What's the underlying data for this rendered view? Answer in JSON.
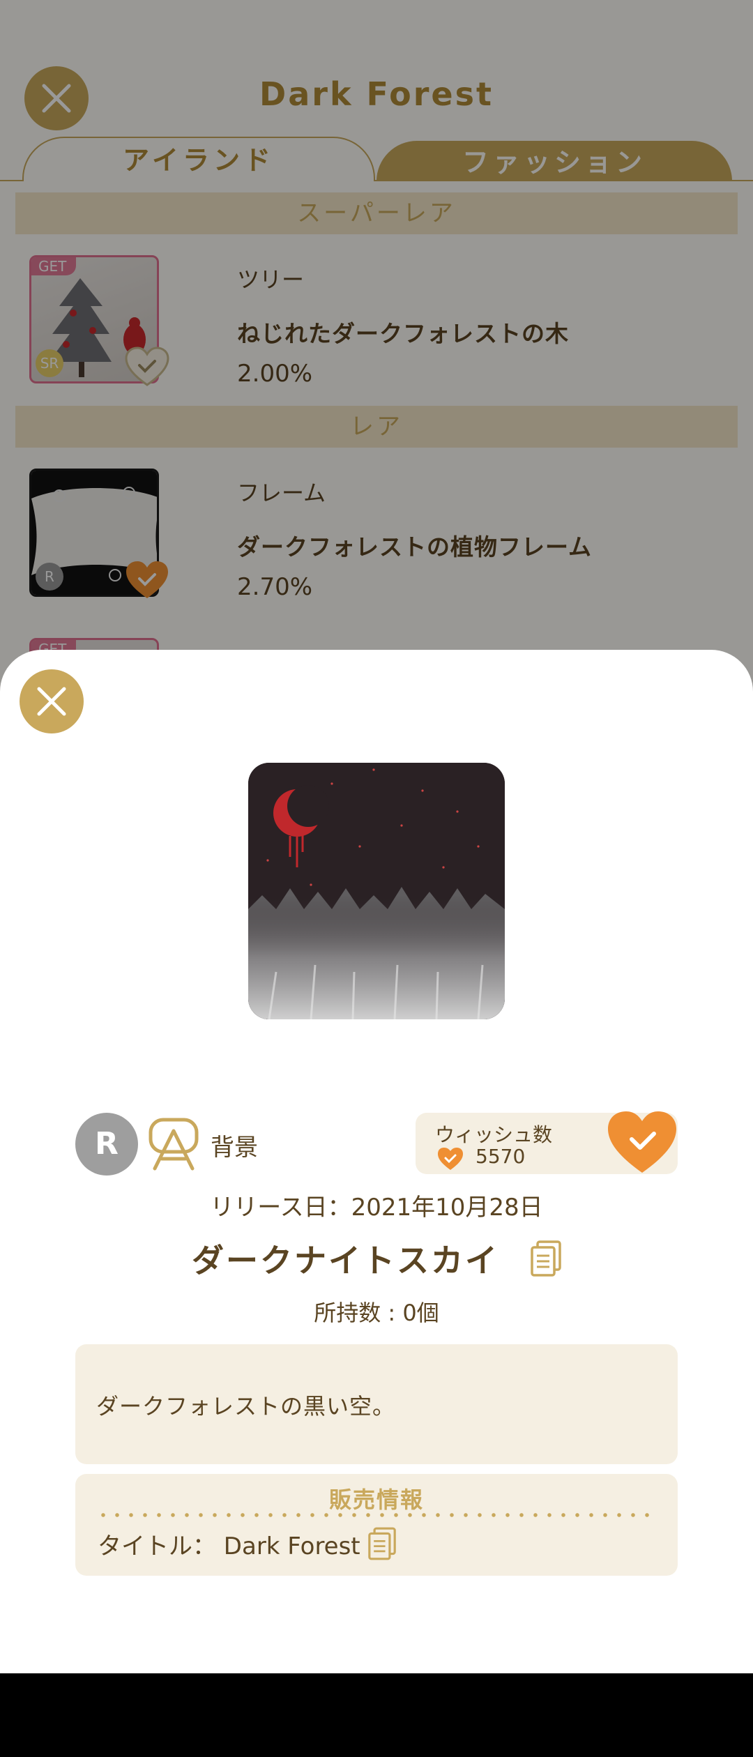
{
  "header": {
    "title": "Dark Forest"
  },
  "tabs": [
    {
      "label": "アイランド"
    },
    {
      "label": "ファッション"
    }
  ],
  "sections": {
    "super_rare": "スーパーレア",
    "rare": "レア"
  },
  "items": [
    {
      "badge": "GET",
      "rarity": "SR",
      "category": "ツリー",
      "name": "ねじれたダークフォレストの木",
      "rate": "2.00%"
    },
    {
      "rarity": "R",
      "category": "フレーム",
      "name": "ダークフォレストの植物フレーム",
      "rate": "2.70%"
    }
  ],
  "partial_item": {
    "badge": "GET"
  },
  "detail": {
    "rarity": "R",
    "type_icon": "background-icon",
    "type_label": "背景",
    "wish_label": "ウィッシュ数",
    "wish_count": "5570",
    "release": "リリース日：2021年10月28日",
    "title": "ダークナイトスカイ",
    "owned": "所持数 : 0個",
    "description": "ダークフォレストの黒い空。",
    "sale_header": "販売情報",
    "sale_title": "タイトル： Dark Forest"
  },
  "colors": {
    "gold": "#c9a85c",
    "brown_text": "#5a4422",
    "beige_panel": "#f5efe2",
    "heart_orange": "#ef8f33",
    "get_pink": "#e27a96"
  }
}
